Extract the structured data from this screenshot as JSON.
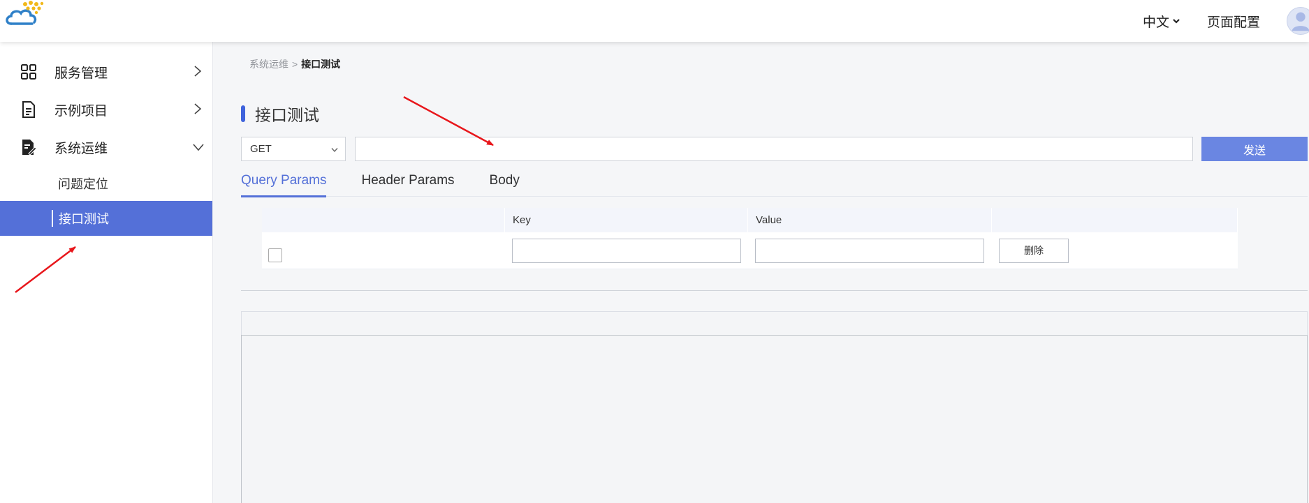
{
  "header": {
    "logo_icon": "cloud-logo-icon",
    "language_label": "中文",
    "page_config_label": "页面配置",
    "avatar_icon": "user-avatar-icon"
  },
  "sidebar": {
    "items": [
      {
        "label": "服务管理",
        "icon": "grid-apps-icon",
        "expanded": false
      },
      {
        "label": "示例项目",
        "icon": "document-icon",
        "expanded": false
      },
      {
        "label": "系统运维",
        "icon": "edit-document-icon",
        "expanded": true,
        "children": [
          {
            "label": "问题定位",
            "active": false
          },
          {
            "label": "接口测试",
            "active": true
          }
        ]
      }
    ]
  },
  "breadcrumb": {
    "parent": "系统运维",
    "separator": ">",
    "current": "接口测试"
  },
  "page": {
    "title": "接口测试"
  },
  "request": {
    "method": "GET",
    "url_value": "",
    "send_label": "发送"
  },
  "tabs": [
    {
      "label": "Query Params",
      "active": true
    },
    {
      "label": "Header Params",
      "active": false
    },
    {
      "label": "Body",
      "active": false
    }
  ],
  "params_table": {
    "headers": [
      "",
      "Key",
      "Value",
      ""
    ],
    "rows": [
      {
        "checked": false,
        "key": "",
        "value": "",
        "delete_label": "删除"
      }
    ]
  },
  "colors": {
    "accent": "#5470d8",
    "send_button": "#6a86e2",
    "annotation_arrow": "#e8161b"
  }
}
